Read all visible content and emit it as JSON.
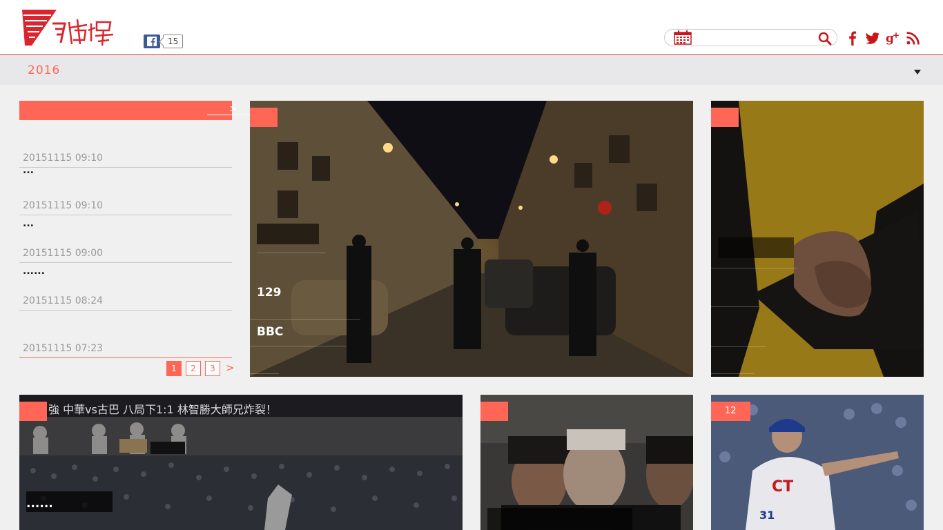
{
  "header": {
    "logo_alt": "風傳媒",
    "fb_like_count": "15",
    "search": {
      "placeholder": "",
      "value": ""
    },
    "social": [
      "facebook-icon",
      "twitter-icon",
      "google-plus-icon",
      "rss-icon"
    ]
  },
  "yearbar": {
    "year": "2016"
  },
  "sidebar": {
    "more_label": ">",
    "items": [
      {
        "title": "",
        "time": "20151115 09:10"
      },
      {
        "title": "...",
        "time": "20151115 09:10"
      },
      {
        "title": "......",
        "time": "20151115 09:00"
      },
      {
        "title": "",
        "time": "20151115 08:24"
      },
      {
        "title": "",
        "time": "20151115 07:23"
      }
    ],
    "pages": [
      "1",
      "2",
      "3"
    ],
    "active_page": "1",
    "next_label": ">"
  },
  "cards": {
    "paris": {
      "tag": "",
      "line1": "129",
      "line2": "BBC"
    },
    "handshake": {
      "tag": ""
    },
    "baseball": {
      "tag": "",
      "banner": "強 中華vs古巴 八局下1:1 林智勝大師兄炸裂！",
      "caption": "......"
    },
    "portrait": {
      "tag": ""
    },
    "player": {
      "tag": "12"
    }
  },
  "colors": {
    "accent": "#ff6655",
    "brand_red": "#c8161d"
  }
}
